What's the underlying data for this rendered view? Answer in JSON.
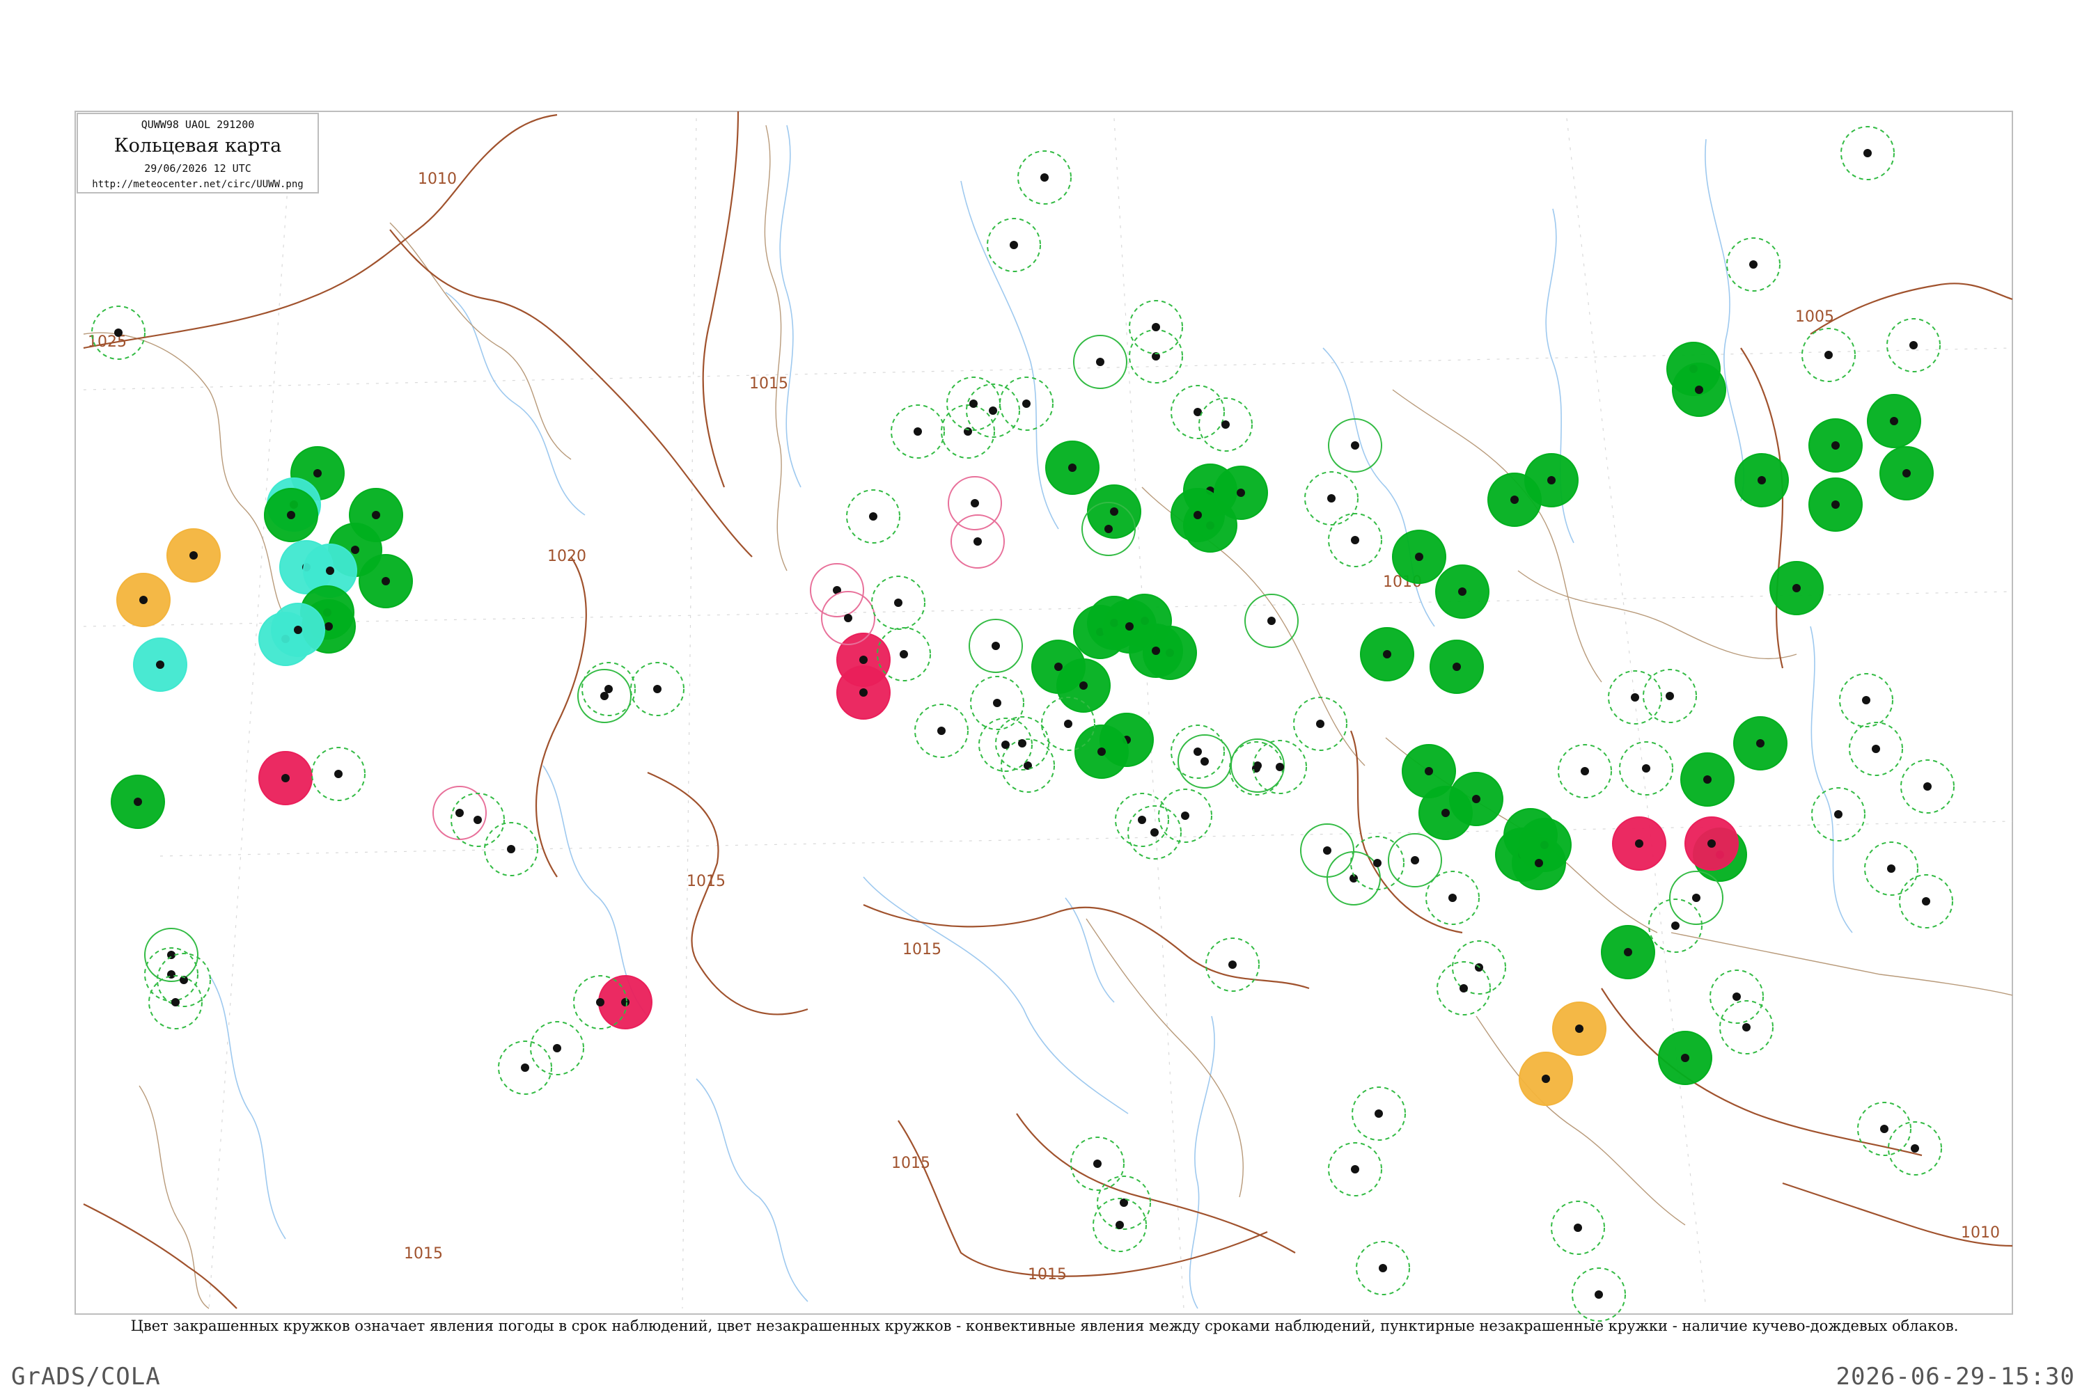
{
  "header": {
    "code": "QUWW98 UAOL 291200",
    "title": "Кольцевая карта",
    "date": "29/06/2026 12 UTC",
    "url": "http://meteocenter.net/circ/UUWW.png"
  },
  "caption": "Цвет закрашенных кружков означает явления погоды в срок наблюдений, цвет незакрашенных кружков - конвективные явления между сроками наблюдений, пунктирные незакрашенные кружки - наличие кучево-дождевых облаков.",
  "footer": {
    "left": "GrADS/COLA",
    "right": "2026-06-29-15:30"
  },
  "isobar_labels": [
    "1025",
    "1015",
    "1020",
    "1015",
    "1015",
    "1010",
    "1015",
    "1015",
    "1010",
    "1005",
    "1010",
    "1015"
  ],
  "colors": {
    "green": "#00b01e",
    "cyan": "#3fe8d0",
    "red": "#ea1f5a",
    "orange": "#f3b43c",
    "pink_ring": "#e8709a",
    "green_ring": "#33bb44",
    "isobar": "#a0522d"
  },
  "station_markers": {
    "filled_green": 60,
    "filled_cyan": 7,
    "filled_red": 7,
    "filled_orange": 4,
    "outline_solid": 18,
    "outline_dashed_green": 53
  }
}
